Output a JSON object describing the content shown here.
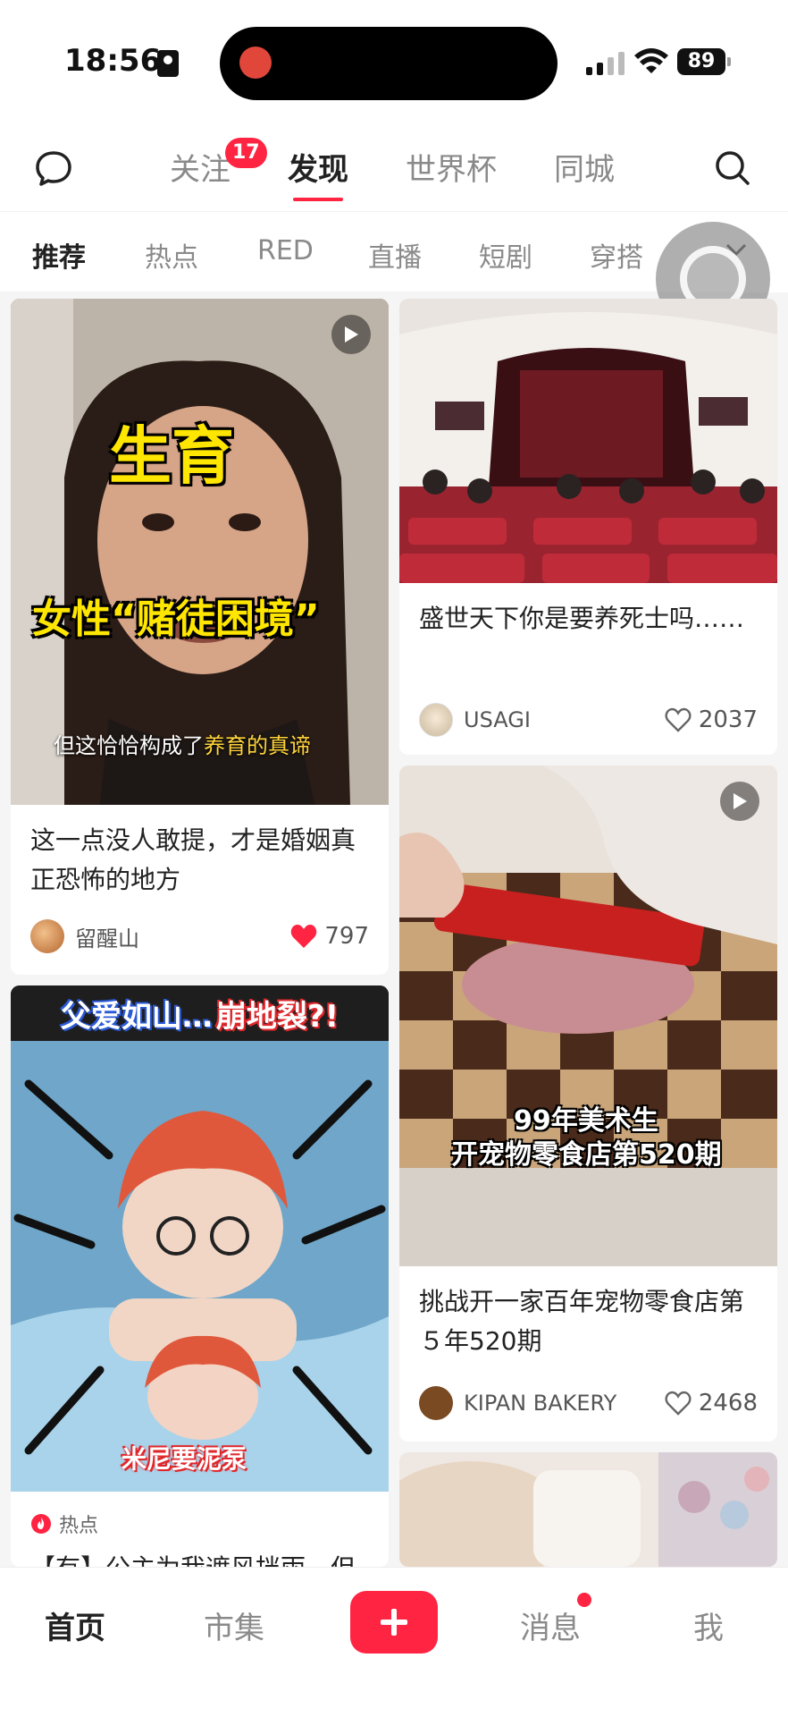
{
  "status_bar": {
    "time": "18:56",
    "battery": "89"
  },
  "top_nav": {
    "tabs": [
      {
        "label": "关注",
        "badge": "17"
      },
      {
        "label": "发现"
      },
      {
        "label": "世界杯"
      },
      {
        "label": "同城"
      }
    ],
    "active_tab": "发现"
  },
  "categories": {
    "items": [
      "推荐",
      "热点",
      "RED",
      "直播",
      "短剧",
      "穿搭"
    ],
    "active": "推荐"
  },
  "feed": {
    "left": [
      {
        "overlay_title": "生育",
        "overlay_subtitle": "女性“赌徒困境”",
        "overlay_caption_prefix": "但这恰恰构成了",
        "overlay_caption_highlight": "养育的真谛",
        "title": "这一点没人敢提，才是婚姻真正恐怖的地方",
        "author": "留醒山",
        "likes": "797",
        "liked": true
      },
      {
        "overlay_top": "父爱如山…",
        "overlay_top_red": "崩地裂?!",
        "overlay_bottom": "米尼要泥泵",
        "tag": "热点",
        "title_partial": "【有】公主为我遮风挡雨，但"
      }
    ],
    "right": [
      {
        "title": "盛世天下你是要养死士吗……",
        "author": "USAGI",
        "likes": "2037",
        "liked": false
      },
      {
        "overlay_text_line1": "99年美术生",
        "overlay_text_line2": "开宠物零食店第520期",
        "title": "挑战开一家百年宠物零食店第５年520期",
        "author": "KIPAN BAKERY",
        "likes": "2468",
        "liked": false
      }
    ]
  },
  "tabbar": {
    "items": [
      "首页",
      "市集",
      "消息",
      "我"
    ],
    "active": "首页"
  },
  "colors": {
    "accent": "#ff2442",
    "text": "#222222",
    "muted": "#8a8a8a"
  },
  "icons": [
    "chat-bubble-icon",
    "search-icon",
    "chevron-down-icon",
    "play-icon",
    "heart-icon",
    "plus-icon",
    "fire-icon"
  ]
}
